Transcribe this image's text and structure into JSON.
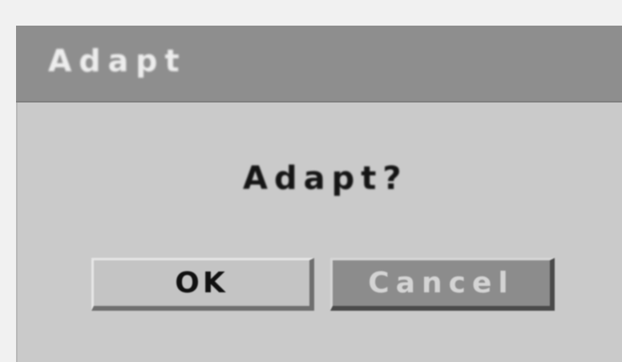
{
  "dialog": {
    "title": "Adapt",
    "message": "Adapt?",
    "buttons": {
      "ok_label": "OK",
      "cancel_label": "Cancel"
    }
  },
  "colors": {
    "title_bar": "#8e8e8e",
    "dialog_body": "#cacaca",
    "ok_button": "#c4c4c4",
    "cancel_button": "#8c8c8c"
  }
}
